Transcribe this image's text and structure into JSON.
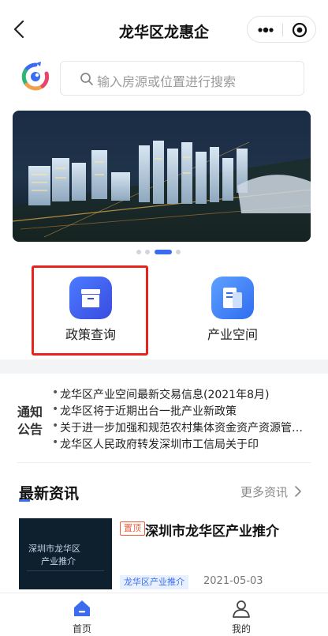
{
  "header": {
    "title": "龙华区龙惠企"
  },
  "search": {
    "placeholder": "输入房源或位置进行搜索"
  },
  "banner": {
    "pages": 4,
    "active_page": 3
  },
  "nav": [
    {
      "label": "政策查询"
    },
    {
      "label": "产业空间"
    }
  ],
  "notice": {
    "badge_top": "通知",
    "badge_bottom": "公告",
    "items": [
      "龙华区产业空间最新交易信息(2021年8月)",
      "龙华区将于近期出台一批产业新政策",
      "关于进一步加强和规范农村集体资金资产资源管理的通知",
      "龙华区人民政府转发深圳市工信局关于印"
    ]
  },
  "news": {
    "section_title": "最新资讯",
    "more_label": "更多资讯",
    "items": [
      {
        "top_badge": "置顶",
        "headline": "深圳市龙华区产业推介",
        "tag": "龙华区产业推介",
        "date": "2021-05-03",
        "thumb_line1": "深圳市龙华区",
        "thumb_line2": "产业推介"
      }
    ]
  },
  "tabbar": [
    {
      "label": "首页",
      "active": true
    },
    {
      "label": "我的",
      "active": false
    }
  ],
  "colors": {
    "accent": "#3b6cf0",
    "highlight_box": "#e8231e",
    "top_badge": "#f05b3b"
  }
}
